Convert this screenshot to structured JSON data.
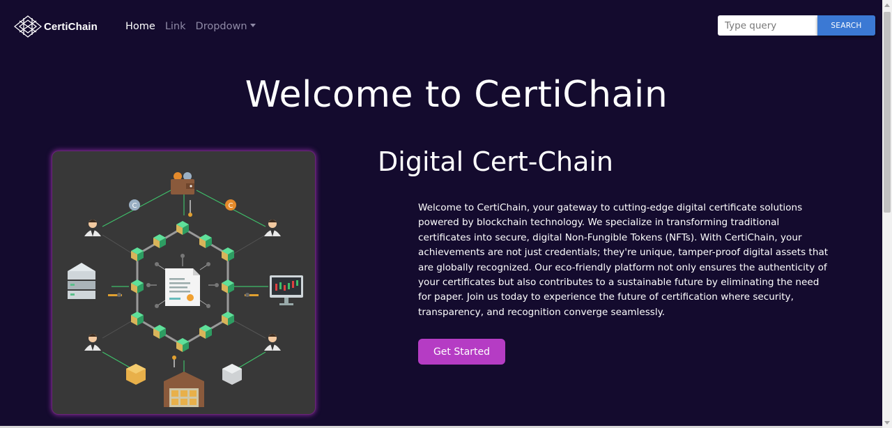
{
  "nav": {
    "brand": "CertiChain",
    "links": [
      {
        "label": "Home"
      },
      {
        "label": "Link"
      },
      {
        "label": "Dropdown"
      }
    ],
    "search_placeholder": "Type query",
    "search_button": "SEARCH"
  },
  "hero": {
    "title": "Welcome to CertiChain",
    "subtitle": "Digital Cert-Chain",
    "description": "Welcome to CertiChain, your gateway to cutting-edge digital certificate solutions powered by blockchain technology. We specialize in transforming traditional certificates into secure, digital Non-Fungible Tokens (NFTs). With CertiChain, your achievements are not just credentials; they're unique, tamper-proof digital assets that are globally recognized. Our eco-friendly platform not only ensures the authenticity of your certificates but also contributes to a sustainable future by eliminating the need for paper. Join us today to experience the future of certification where security, transparency, and recognition converge seamlessly.",
    "cta_label": "Get Started"
  },
  "colors": {
    "page_background": "#140b2e",
    "search_button": "#3b79d4",
    "cta_button": "#b53cc4",
    "illustration_background": "#383838",
    "chain_block": "#2ecc71"
  },
  "icons": {
    "brand_logo": "lattice-logo-icon",
    "illustration": "blockchain-network-illustration"
  }
}
